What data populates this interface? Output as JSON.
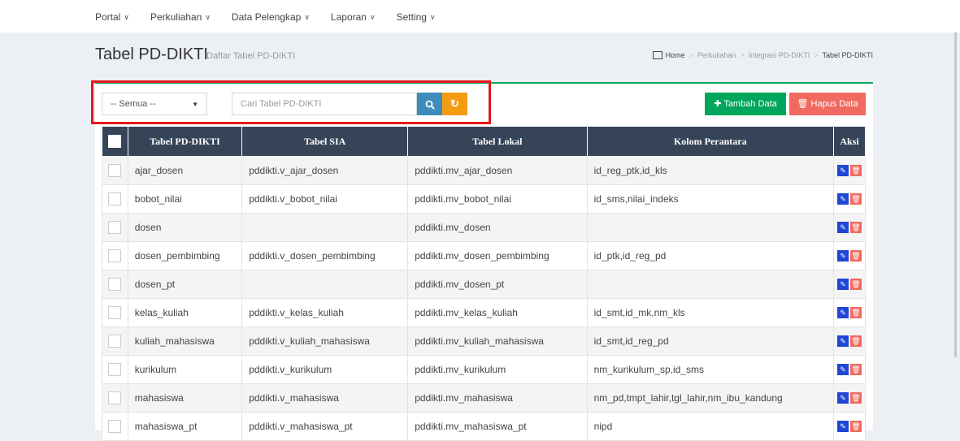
{
  "nav": {
    "items": [
      {
        "label": "Portal"
      },
      {
        "label": "Perkuliahan"
      },
      {
        "label": "Data Pelengkap"
      },
      {
        "label": "Laporan"
      },
      {
        "label": "Setting"
      }
    ],
    "caret": "∨"
  },
  "header": {
    "title": "Tabel PD-DIKTI",
    "subtitle": "Daftar Tabel PD-DIKTI"
  },
  "breadcrumb": {
    "items": [
      "Home",
      "Perkuliahan",
      "Integrasi PD-DIKTI",
      "Tabel PD-DIKTI"
    ],
    "separator": ">"
  },
  "toolbar": {
    "filter_value": "-- Semua --",
    "search_placeholder": "Cari Tabel PD-DIKTI",
    "add_label": "Tambah Data",
    "delete_label": "Hapus Data"
  },
  "table": {
    "columns": [
      "Tabel PD-DIKTI",
      "Tabel SIA",
      "Tabel Lokal",
      "Kolom Perantara",
      "Aksi"
    ],
    "rows": [
      [
        "ajar_dosen",
        "pddikti.v_ajar_dosen",
        "pddikti.mv_ajar_dosen",
        "id_reg_ptk,id_kls"
      ],
      [
        "bobot_nilai",
        "pddikti.v_bobot_nilai",
        "pddikti.mv_bobot_nilai",
        "id_sms,nilai_indeks"
      ],
      [
        "dosen",
        "",
        "pddikti.mv_dosen",
        ""
      ],
      [
        "dosen_pembimbing",
        "pddikti.v_dosen_pembimbing",
        "pddikti.mv_dosen_pembimbing",
        "id_ptk,id_reg_pd"
      ],
      [
        "dosen_pt",
        "",
        "pddikti.mv_dosen_pt",
        ""
      ],
      [
        "kelas_kuliah",
        "pddikti.v_kelas_kuliah",
        "pddikti.mv_kelas_kuliah",
        "id_smt,id_mk,nm_kls"
      ],
      [
        "kuliah_mahasiswa",
        "pddikti.v_kuliah_mahasiswa",
        "pddikti.mv_kuliah_mahasiswa",
        "id_smt,id_reg_pd"
      ],
      [
        "kurikulum",
        "pddikti.v_kurikulum",
        "pddikti.mv_kurikulum",
        "nm_kurikulum_sp,id_sms"
      ],
      [
        "mahasiswa",
        "pddikti.v_mahasiswa",
        "pddikti.mv_mahasiswa",
        "nm_pd,tmpt_lahir,tgl_lahir,nm_ibu_kandung"
      ],
      [
        "mahasiswa_pt",
        "pddikti.v_mahasiswa_pt",
        "pddikti.mv_mahasiswa_pt",
        "nipd"
      ]
    ]
  },
  "colors": {
    "header_bg": "#364458",
    "accent_green": "#00a65a",
    "accent_red": "#f16a5f",
    "search_blue": "#3c8dbc",
    "refresh_orange": "#f39c12",
    "highlight_red": "#e8141b"
  }
}
